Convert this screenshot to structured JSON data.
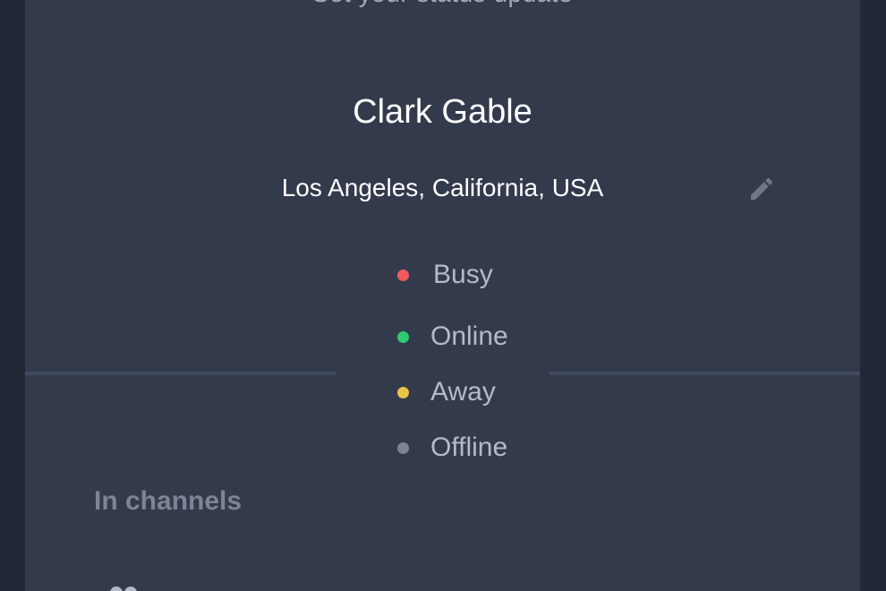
{
  "profile": {
    "top_text": "Set your status update",
    "name": "Clark Gable",
    "location": "Los Angeles, California, USA"
  },
  "edit_icon": "pencil-icon",
  "status_options": [
    {
      "label": "Busy",
      "color": "#ef5a5f"
    },
    {
      "label": "Online",
      "color": "#2ecc71"
    },
    {
      "label": "Away",
      "color": "#e8c547"
    },
    {
      "label": "Offline",
      "color": "#7c8496"
    }
  ],
  "section": {
    "channels_heading": "In channels"
  },
  "colors": {
    "background": "#222735",
    "panel": "#333a4c",
    "divider": "#414a62",
    "text_primary": "#ffffff",
    "text_secondary": "#b3bac9",
    "text_muted": "#7c8496"
  }
}
